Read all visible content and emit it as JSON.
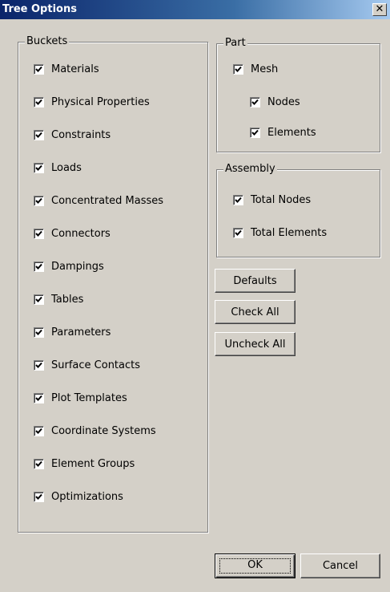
{
  "window": {
    "title": "Tree Options",
    "close_label": "✕"
  },
  "buckets": {
    "legend": "Buckets",
    "items": [
      {
        "label": "Materials",
        "checked": true
      },
      {
        "label": "Physical Properties",
        "checked": true
      },
      {
        "label": "Constraints",
        "checked": true
      },
      {
        "label": "Loads",
        "checked": true
      },
      {
        "label": "Concentrated Masses",
        "checked": true
      },
      {
        "label": "Connectors",
        "checked": true
      },
      {
        "label": "Dampings",
        "checked": true
      },
      {
        "label": "Tables",
        "checked": true
      },
      {
        "label": "Parameters",
        "checked": true
      },
      {
        "label": "Surface Contacts",
        "checked": true
      },
      {
        "label": "Plot Templates",
        "checked": true
      },
      {
        "label": "Coordinate Systems",
        "checked": true
      },
      {
        "label": "Element Groups",
        "checked": true
      },
      {
        "label": "Optimizations",
        "checked": true
      }
    ]
  },
  "part": {
    "legend": "Part",
    "mesh": {
      "label": "Mesh",
      "checked": true
    },
    "nodes": {
      "label": "Nodes",
      "checked": true
    },
    "elements": {
      "label": "Elements",
      "checked": true
    }
  },
  "assembly": {
    "legend": "Assembly",
    "total_nodes": {
      "label": "Total Nodes",
      "checked": true
    },
    "total_elements": {
      "label": "Total Elements",
      "checked": true
    }
  },
  "buttons": {
    "defaults": "Defaults",
    "check_all": "Check All",
    "uncheck_all": "Uncheck All",
    "ok": "OK",
    "cancel": "Cancel"
  }
}
